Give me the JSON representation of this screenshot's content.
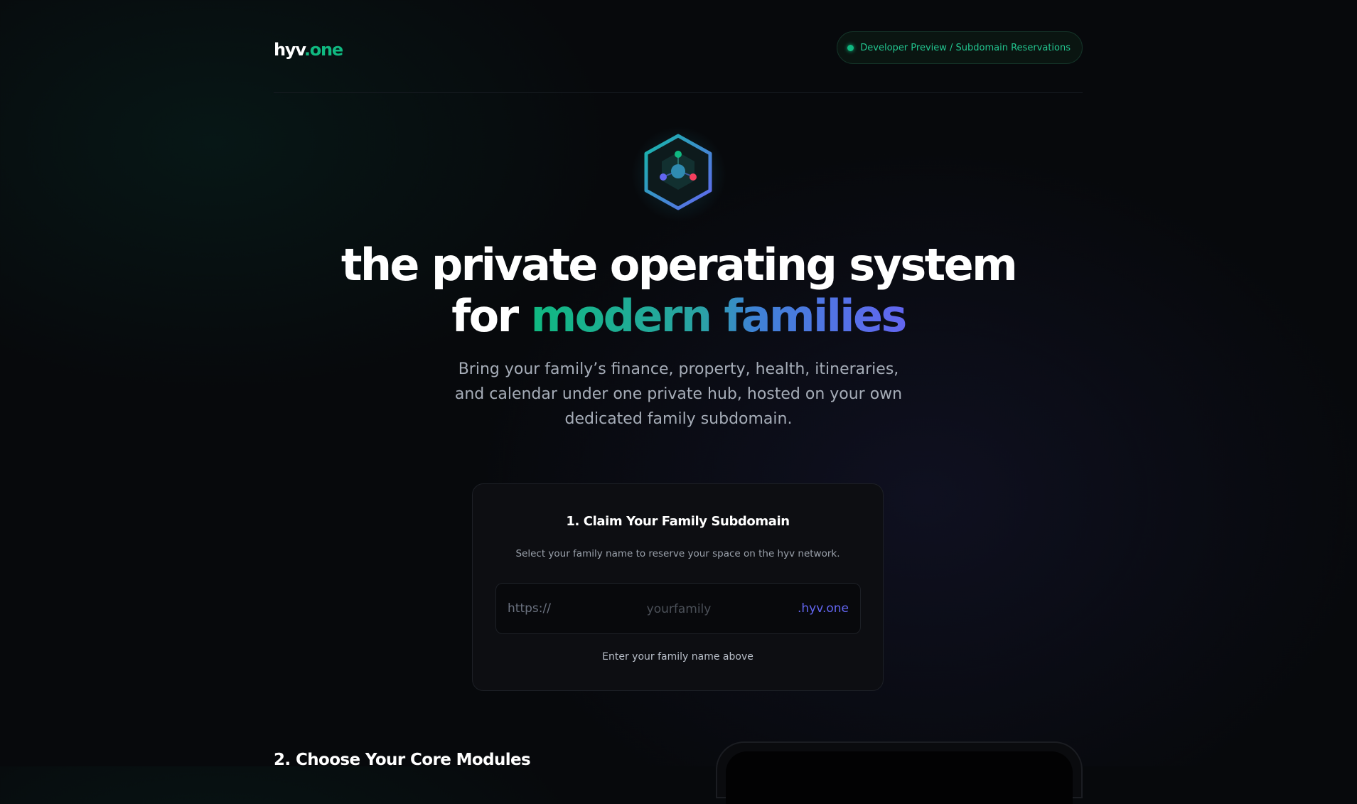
{
  "brand": {
    "name": "hyv",
    "tld": ".one"
  },
  "badge": {
    "label": "Developer Preview / Subdomain Reservations"
  },
  "hero": {
    "icon": "hexagon-network-icon",
    "title_line1": "the private operating system",
    "title_line2_prefix": "for ",
    "title_line2_highlight": "modern families",
    "subtitle": "Bring your family’s finance, property, health, itineraries, and calendar under one private hub, hosted on your own dedicated family subdomain."
  },
  "claim": {
    "title": "1. Claim Your Family Subdomain",
    "description": "Select your family name to reserve your space on the hyv network.",
    "prefix": "https://",
    "placeholder": "yourfamily",
    "value": "",
    "suffix": ".hyv.one",
    "hint": "Enter your family name above"
  },
  "modules": {
    "title": "2. Choose Your Core Modules"
  },
  "colors": {
    "accent_green": "#10b981",
    "accent_indigo": "#6366f1",
    "background": "#07090c"
  }
}
